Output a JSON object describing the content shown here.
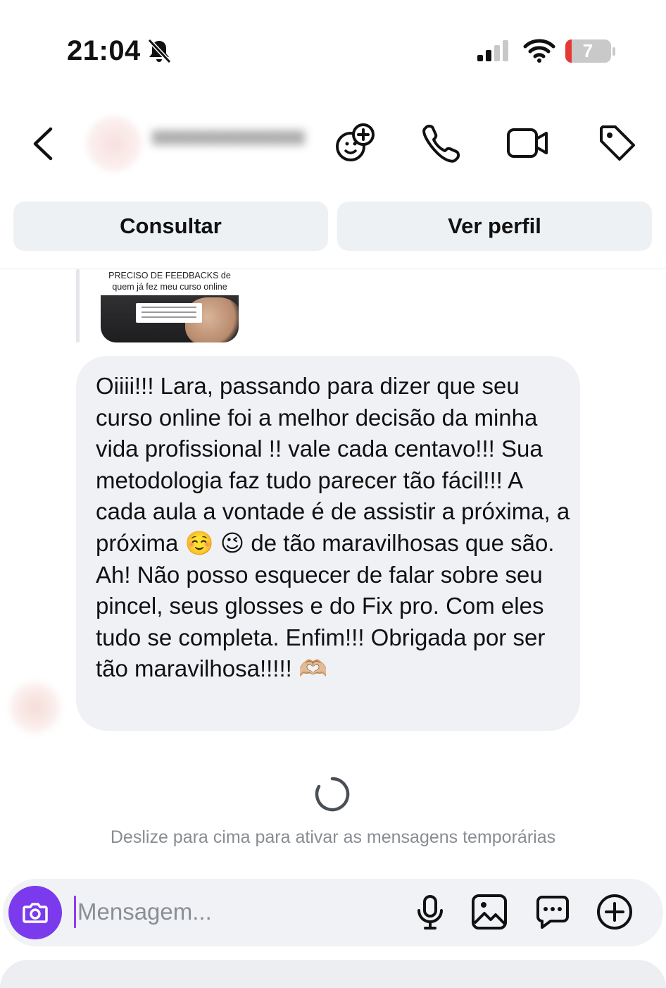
{
  "status_bar": {
    "time": "21:04",
    "battery": "7",
    "battery_color": "#e53935"
  },
  "header": {
    "back_icon": "chevron-left-icon",
    "actions": [
      "face-add-icon",
      "phone-icon",
      "video-camera-icon",
      "tag-icon"
    ]
  },
  "action_buttons": {
    "consult_label": "Consultar",
    "profile_label": "Ver perfil"
  },
  "story_reply": {
    "caption_line1": "PRECISO DE FEEDBACKS de",
    "caption_line2": "quem já fez meu curso online"
  },
  "message": {
    "text": "Oiiii!!! Lara, passando para dizer que seu curso online foi a melhor decisão da minha vida profissional !! vale cada centavo!!! Sua metodologia faz tudo parecer tão fácil!!!  A cada aula a vontade é de assistir a próxima, a próxima ☺️ 😉  de tão maravilhosas que são.  Ah! Não posso esquecer de falar sobre seu pincel, seus glosses e do Fix pro. Com eles tudo se completa. Enfim!!! Obrigada por ser tão maravilhosa!!!!!  🫶🏼"
  },
  "temporary_hint": "Deslize para cima para ativar as mensagens temporárias",
  "composer": {
    "placeholder": "Mensagem...",
    "accent_color": "#7c3aed",
    "icons": [
      "microphone-icon",
      "image-icon",
      "chat-bubble-icon",
      "plus-circle-icon"
    ]
  }
}
